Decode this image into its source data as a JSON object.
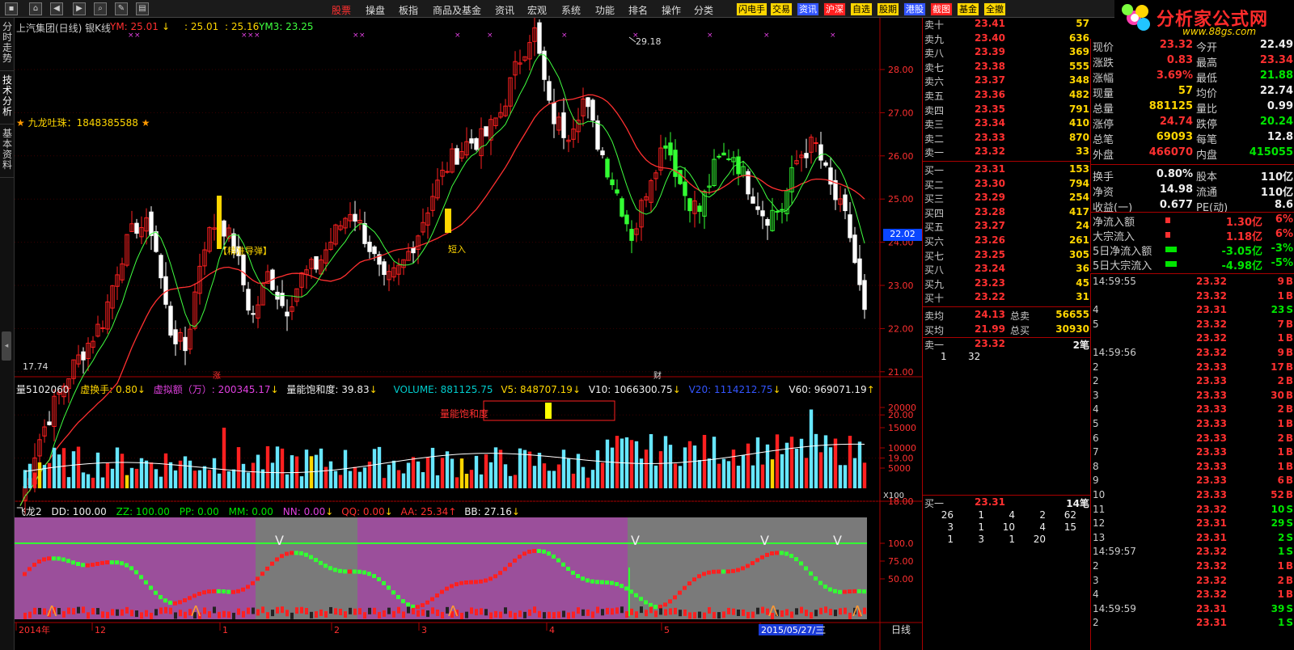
{
  "topbar": {
    "menus": [
      "股票",
      "操盘",
      "板指",
      "商品及基金",
      "资讯",
      "宏观",
      "系统",
      "功能",
      "排名",
      "操作",
      "分类"
    ],
    "quick": [
      "闪电手",
      "交易",
      "资讯",
      "沪深",
      "自选",
      "股期",
      "港股",
      "截图",
      "基金",
      "全撤"
    ]
  },
  "logo": {
    "text": "分析家公式网",
    "url": "www.88gs.com"
  },
  "sidetabs": [
    "分时走势",
    "技术分析",
    "基本资料"
  ],
  "chart": {
    "header": {
      "title": "上汽集团(日线) 银K线",
      "ym": "YM: 25.01",
      "v1": ": 25.01",
      "v2": ": 25.16",
      "ym3": "YM3: 23.25"
    },
    "badge": "九龙吐珠：1848385588",
    "annotations": {
      "peak": "29.18",
      "low": "17.74",
      "precise": "【精准导弹】",
      "short": "短入",
      "zhang": "涨",
      "cai": "财"
    },
    "price_label": "22.02",
    "yaxis": [
      "28.00",
      "27.00",
      "26.00",
      "25.00",
      "24.00",
      "23.00",
      "22.00",
      "21.00",
      "20.00",
      "19.00",
      "18.00"
    ],
    "vol_header": {
      "lead": "量5102060",
      "hs": "虚换手: 0.80",
      "xn": "虚拟额（万）: 200345.17",
      "bn": "量能饱和度: 39.83",
      "volume": "VOLUME: 881125.75",
      "v5": "V5: 848707.19",
      "v10": "V10: 1066300.75",
      "v20": "V20: 1114212.75",
      "v60": "V60: 969071.19"
    },
    "saturation_label": "量能饱和度",
    "vol_axis": [
      "20000",
      "15000",
      "10000",
      "5000",
      "X100"
    ],
    "ind_header": {
      "name": "飞龙2",
      "dd": "DD: 100.00",
      "zz": "ZZ: 100.00",
      "pp": "PP: 0.00",
      "mm": "MM: 0.00",
      "nn": "NN: 0.00",
      "qq": "QQ: 0.00",
      "aa": "AA: 25.34",
      "bb": "BB: 27.16"
    },
    "ind_axis": [
      "100.0",
      "75.00",
      "50.00"
    ],
    "dates": [
      "2014年",
      "12",
      "1",
      "2",
      "3",
      "4",
      "5",
      "2015/05/27/三"
    ],
    "period": "日线",
    "watermark": "分析家公式网"
  },
  "orderbook": {
    "asks": [
      [
        "卖十",
        "23.41",
        "57"
      ],
      [
        "卖九",
        "23.40",
        "636"
      ],
      [
        "卖八",
        "23.39",
        "369"
      ],
      [
        "卖七",
        "23.38",
        "555"
      ],
      [
        "卖六",
        "23.37",
        "348"
      ],
      [
        "卖五",
        "23.36",
        "482"
      ],
      [
        "卖四",
        "23.35",
        "791"
      ],
      [
        "卖三",
        "23.34",
        "410"
      ],
      [
        "卖二",
        "23.33",
        "870"
      ],
      [
        "卖一",
        "23.32",
        "33"
      ]
    ],
    "bids": [
      [
        "买一",
        "23.31",
        "153"
      ],
      [
        "买二",
        "23.30",
        "794"
      ],
      [
        "买三",
        "23.29",
        "254"
      ],
      [
        "买四",
        "23.28",
        "417"
      ],
      [
        "买五",
        "23.27",
        "24"
      ],
      [
        "买六",
        "23.26",
        "261"
      ],
      [
        "买七",
        "23.25",
        "305"
      ],
      [
        "买八",
        "23.24",
        "36"
      ],
      [
        "买九",
        "23.23",
        "45"
      ],
      [
        "买十",
        "23.22",
        "31"
      ]
    ],
    "avg": [
      [
        "卖均",
        "24.13",
        "总卖",
        "56655"
      ],
      [
        "买均",
        "21.99",
        "总买",
        "30930"
      ]
    ],
    "sell1": {
      "label": "卖一",
      "price": "23.32",
      "count": "2笔"
    },
    "sell1_queue": [
      "1",
      "32"
    ],
    "buy1": {
      "label": "买一",
      "price": "23.31",
      "count": "14笔"
    },
    "buy1_queue": [
      [
        "26",
        "1",
        "4",
        "2",
        "62"
      ],
      [
        "3",
        "1",
        "10",
        "4",
        "15"
      ],
      [
        "1",
        "3",
        "1",
        "20",
        ""
      ]
    ]
  },
  "info": {
    "rows": [
      [
        "现价",
        "23.32",
        "今开",
        "22.49"
      ],
      [
        "涨跌",
        "0.83",
        "最高",
        "23.34"
      ],
      [
        "涨幅",
        "3.69%",
        "最低",
        "21.88"
      ],
      [
        "现量",
        "57",
        "均价",
        "22.74"
      ],
      [
        "总量",
        "881125",
        "量比",
        "0.99"
      ],
      [
        "涨停",
        "24.74",
        "跌停",
        "20.24"
      ],
      [
        "总笔",
        "69093",
        "每笔",
        "12.8"
      ],
      [
        "外盘",
        "466070",
        "内盘",
        "415055"
      ],
      [
        "换手",
        "0.80%",
        "股本",
        "110亿"
      ],
      [
        "净资",
        "14.98",
        "流通",
        "110亿"
      ],
      [
        "收益(一)",
        "0.677",
        "PE(动)",
        "8.6"
      ]
    ],
    "flows": [
      [
        "净流入额",
        "1.30亿",
        "6%"
      ],
      [
        "大宗流入",
        "1.18亿",
        "6%"
      ],
      [
        "5日净流入额",
        "-3.05亿",
        "-3%"
      ],
      [
        "5日大宗流入",
        "-4.98亿",
        "-5%"
      ]
    ]
  },
  "ticks": [
    [
      "14:59:55",
      "23.32",
      "9",
      "B"
    ],
    [
      "",
      "23.32",
      "1",
      "B"
    ],
    [
      "4",
      "23.31",
      "23",
      "S"
    ],
    [
      "5",
      "23.32",
      "7",
      "B"
    ],
    [
      "",
      "23.32",
      "1",
      "B"
    ],
    [
      "14:59:56",
      "23.32",
      "9",
      "B"
    ],
    [
      "2",
      "23.33",
      "17",
      "B"
    ],
    [
      "2",
      "23.33",
      "2",
      "B"
    ],
    [
      "3",
      "23.33",
      "30",
      "B"
    ],
    [
      "4",
      "23.33",
      "2",
      "B"
    ],
    [
      "5",
      "23.33",
      "1",
      "B"
    ],
    [
      "6",
      "23.33",
      "2",
      "B"
    ],
    [
      "7",
      "23.33",
      "1",
      "B"
    ],
    [
      "8",
      "23.33",
      "1",
      "B"
    ],
    [
      "9",
      "23.33",
      "6",
      "B"
    ],
    [
      "10",
      "23.33",
      "52",
      "B"
    ],
    [
      "11",
      "23.32",
      "10",
      "S"
    ],
    [
      "12",
      "23.31",
      "29",
      "S"
    ],
    [
      "13",
      "23.31",
      "2",
      "S"
    ],
    [
      "14:59:57",
      "23.32",
      "1",
      "S"
    ],
    [
      "2",
      "23.32",
      "1",
      "B"
    ],
    [
      "3",
      "23.32",
      "2",
      "B"
    ],
    [
      "4",
      "23.32",
      "1",
      "B"
    ],
    [
      "14:59:59",
      "23.31",
      "39",
      "S"
    ],
    [
      "2",
      "23.31",
      "1",
      "S"
    ]
  ]
}
